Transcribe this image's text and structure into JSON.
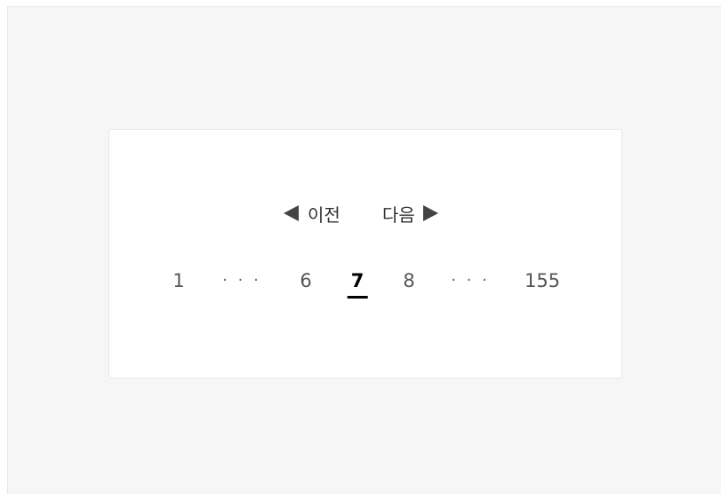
{
  "pagination": {
    "prev_label": "이전",
    "next_label": "다음",
    "prev_icon": "triangle-left-icon",
    "next_icon": "triangle-right-icon",
    "pages": {
      "first": "1",
      "ellipsis_left": "· · ·",
      "before": "6",
      "current": "7",
      "after": "8",
      "ellipsis_right": "· · ·",
      "last": "155"
    },
    "current_page": 7,
    "total_pages": 155
  },
  "colors": {
    "background": "#f6f6f6",
    "card": "#ffffff",
    "active_text": "#000000",
    "inactive_text": "#555555",
    "arrow": "#444444"
  }
}
